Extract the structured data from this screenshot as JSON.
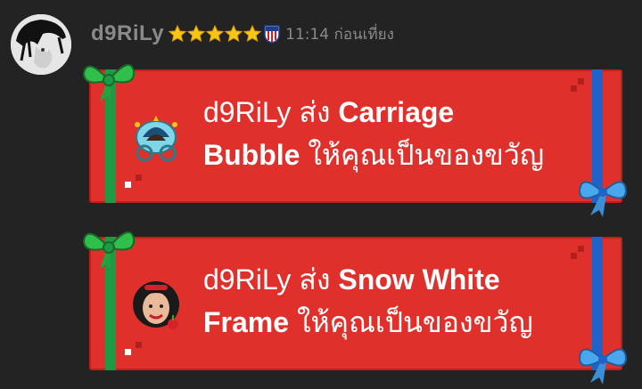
{
  "message": {
    "username": "d9RiLy",
    "star_count": 5,
    "time": "11:14 ก่อนเที่ยง"
  },
  "gifts": [
    {
      "sender": "d9RiLy",
      "verb": "ส่ง",
      "item_line1": "Carriage",
      "item_line2": "Bubble",
      "suffix": "ให้คุณเป็นของขวัญ",
      "icon": "carriage-icon"
    },
    {
      "sender": "d9RiLy",
      "verb": "ส่ง",
      "item_line1": "Snow White",
      "item_line2": "Frame",
      "suffix": "ให้คุณเป็นของขวัญ",
      "icon": "snow-white-frame-icon"
    }
  ],
  "colors": {
    "background": "#232323",
    "card": "#e0302c",
    "green_ribbon": "#1e9a45",
    "blue_ribbon": "#1e63c9",
    "star": "#f5c518"
  }
}
